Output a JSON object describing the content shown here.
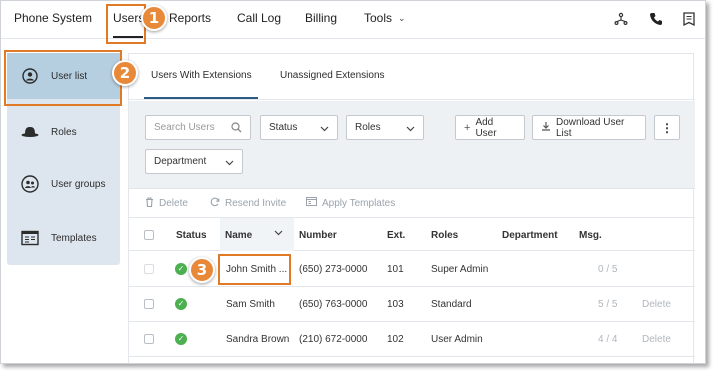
{
  "topnav": {
    "items": [
      "Phone System",
      "Users",
      "Reports",
      "Call Log",
      "Billing",
      "Tools"
    ],
    "icons": [
      "org-chart-icon",
      "phone-icon",
      "document-icon"
    ]
  },
  "sidebar": {
    "items": [
      {
        "label": "User list",
        "icon": "user-circle-icon"
      },
      {
        "label": "Roles",
        "icon": "hat-icon"
      },
      {
        "label": "User groups",
        "icon": "users-icon"
      },
      {
        "label": "Templates",
        "icon": "template-icon"
      }
    ]
  },
  "tabs": [
    "Users With Extensions",
    "Unassigned Extensions"
  ],
  "filters": {
    "search_placeholder": "Search Users",
    "status": "Status",
    "roles": "Roles",
    "department": "Department",
    "add_user": "Add User",
    "download": "Download User List"
  },
  "actions": [
    "Delete",
    "Resend Invite",
    "Apply Templates"
  ],
  "table": {
    "headers": [
      "Status",
      "Name",
      "Number",
      "Ext.",
      "Roles",
      "Department",
      "Msg."
    ],
    "rows": [
      {
        "name": "John Smith ...",
        "number": "(650) 273-0000",
        "ext": "101",
        "role": "Super Admin",
        "department": "",
        "msg": "0 / 5",
        "delete": ""
      },
      {
        "name": "Sam Smith",
        "number": "(650) 763-0000",
        "ext": "103",
        "role": "Standard",
        "department": "",
        "msg": "5 / 5",
        "delete": "Delete"
      },
      {
        "name": "Sandra Brown",
        "number": "(210) 672-0000",
        "ext": "102",
        "role": "User Admin",
        "department": "",
        "msg": "4 / 4",
        "delete": "Delete"
      }
    ]
  },
  "callouts": [
    "1",
    "2",
    "3"
  ],
  "colors": {
    "accent": "#e8893a",
    "sidebar_bg": "#dde6ee",
    "sidebar_active": "#b6cfe0",
    "status_ok": "#4caf50",
    "tab_underline": "#2e5d84"
  }
}
